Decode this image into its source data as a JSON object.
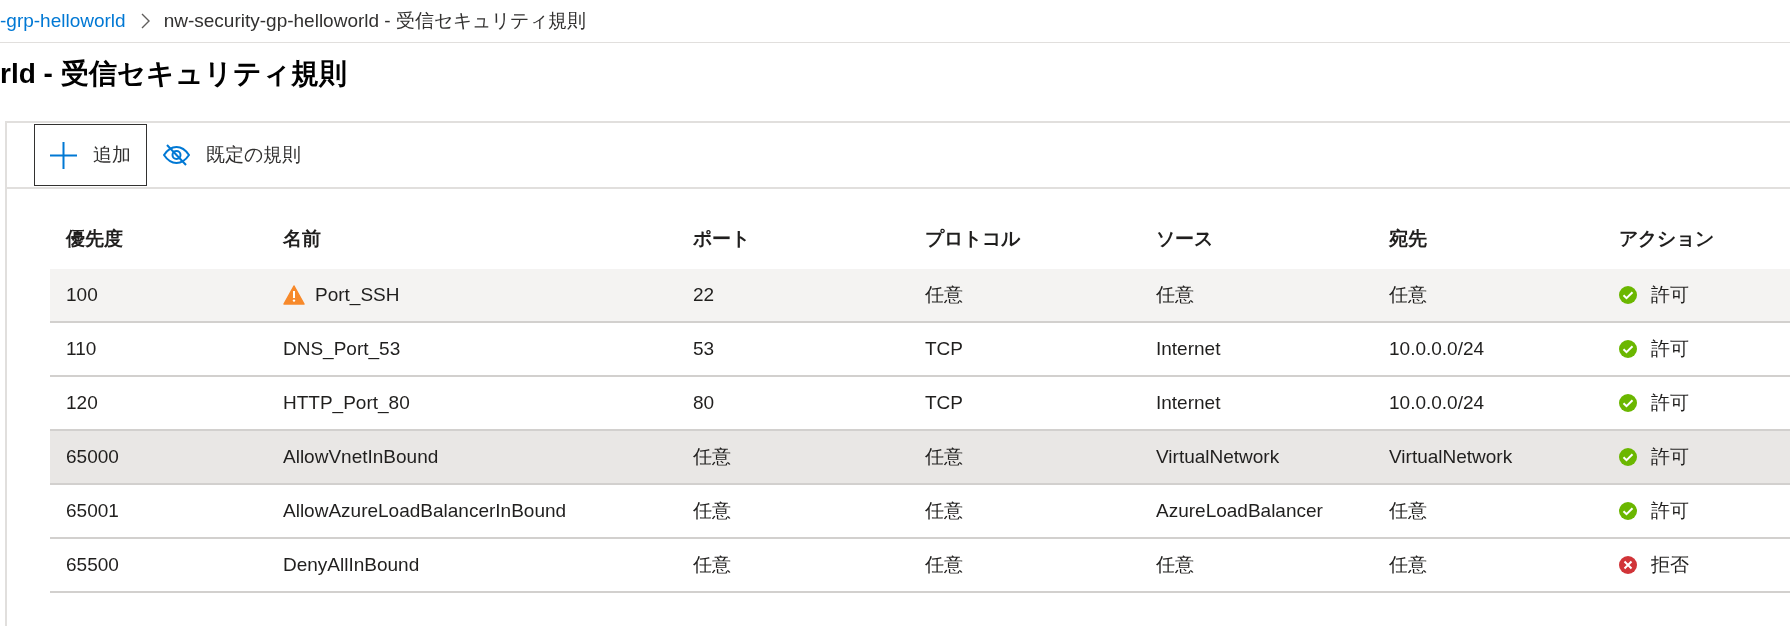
{
  "breadcrumb": [
    {
      "label": "-grp-helloworld",
      "kind": "link"
    },
    {
      "label": "nw-security-gp-helloworld - 受信セキュリティ規則",
      "kind": "current"
    }
  ],
  "page_title": "rld - 受信セキュリティ規則",
  "toolbar": [
    {
      "label": "追加",
      "kind": "add",
      "focused": true
    },
    {
      "label": "既定の規則",
      "kind": "hide",
      "focused": false
    }
  ],
  "table": {
    "columns": [
      "優先度",
      "名前",
      "ポート",
      "プロトコル",
      "ソース",
      "宛先",
      "アクション"
    ],
    "rows": [
      {
        "priority": "100",
        "name": "Port_SSH",
        "warning": true,
        "port": "22",
        "protocol": "任意",
        "source": "任意",
        "destination": "任意",
        "action": {
          "label": "許可",
          "kind": "allow"
        },
        "hovered": true,
        "selected": false
      },
      {
        "priority": "110",
        "name": "DNS_Port_53",
        "warning": false,
        "port": "53",
        "protocol": "TCP",
        "source": "Internet",
        "destination": "10.0.0.0/24",
        "action": {
          "label": "許可",
          "kind": "allow"
        },
        "hovered": false,
        "selected": false
      },
      {
        "priority": "120",
        "name": "HTTP_Port_80",
        "warning": false,
        "port": "80",
        "protocol": "TCP",
        "source": "Internet",
        "destination": "10.0.0.0/24",
        "action": {
          "label": "許可",
          "kind": "allow"
        },
        "hovered": false,
        "selected": false
      },
      {
        "priority": "65000",
        "name": "AllowVnetInBound",
        "warning": false,
        "port": "任意",
        "protocol": "任意",
        "source": "VirtualNetwork",
        "destination": "VirtualNetwork",
        "action": {
          "label": "許可",
          "kind": "allow"
        },
        "hovered": false,
        "selected": true
      },
      {
        "priority": "65001",
        "name": "AllowAzureLoadBalancerInBound",
        "warning": false,
        "port": "任意",
        "protocol": "任意",
        "source": "AzureLoadBalancer",
        "destination": "任意",
        "action": {
          "label": "許可",
          "kind": "allow"
        },
        "hovered": false,
        "selected": false
      },
      {
        "priority": "65500",
        "name": "DenyAllInBound",
        "warning": false,
        "port": "任意",
        "protocol": "任意",
        "source": "任意",
        "destination": "任意",
        "action": {
          "label": "拒否",
          "kind": "deny"
        },
        "hovered": false,
        "selected": false
      }
    ]
  }
}
